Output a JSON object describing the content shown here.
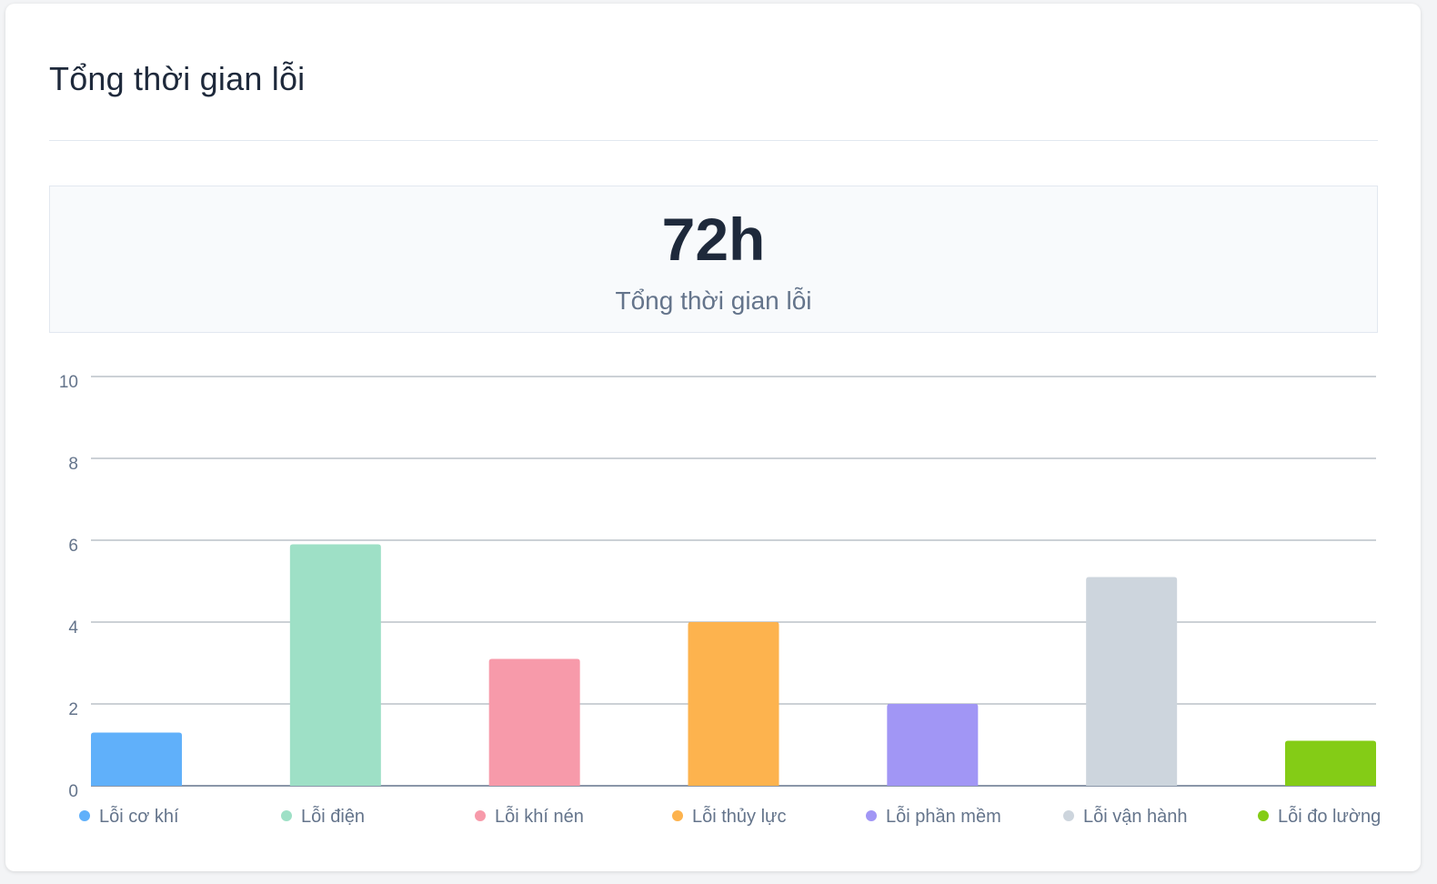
{
  "card": {
    "title": "Tổng thời gian lỗi"
  },
  "summary": {
    "value": "72h",
    "label": "Tổng thời gian lỗi"
  },
  "chart_data": {
    "type": "bar",
    "categories": [
      "Lỗi cơ khí",
      "Lỗi điện",
      "Lỗi khí nén",
      "Lỗi thủy lực",
      "Lỗi phần mềm",
      "Lỗi vận hành",
      "Lỗi đo lường"
    ],
    "values": [
      1.3,
      5.9,
      3.1,
      4.0,
      2.0,
      5.1,
      1.1
    ],
    "colors": [
      "#60b0fa",
      "#9ee0c6",
      "#f79aaa",
      "#fdb34e",
      "#a196f5",
      "#cdd5dd",
      "#84cc16"
    ],
    "yticks": [
      0,
      2,
      4,
      6,
      8,
      10
    ],
    "ylim": [
      0,
      10
    ],
    "grid": true,
    "legend": "bottom"
  }
}
